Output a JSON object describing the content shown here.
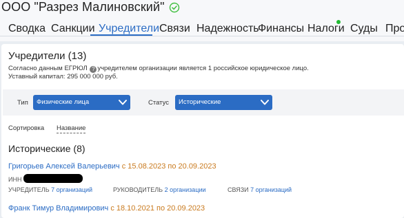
{
  "company": {
    "name": "ООО \"Разрез Малиновский\""
  },
  "tabs": [
    {
      "label": "Сводка"
    },
    {
      "label": "Санкции"
    },
    {
      "label": "Учредители"
    },
    {
      "label": "Связи"
    },
    {
      "label": "Надежность"
    },
    {
      "label": "Финансы"
    },
    {
      "label": "Налоги"
    },
    {
      "label": "Суды"
    },
    {
      "label": "Пров"
    }
  ],
  "colors": {
    "accent": "#2b6cc4",
    "dates": "#c97a1e",
    "notification_dot": "#22bb33",
    "verified": "#3fbf3f"
  },
  "section": {
    "title": "Учредители (13)",
    "desc_before": "Согласно данным ЕГРЮЛ ",
    "desc_after": "учредителем организации является 1 российское юридическое лицо.",
    "capital": "Уставный капитал: 295 000 000 руб."
  },
  "filters": {
    "type_label": "Тип",
    "type_value": "Физические лица",
    "status_label": "Статус",
    "status_value": "Исторические"
  },
  "sort": {
    "label": "Сортировка",
    "value": "Название"
  },
  "group": {
    "title": "Исторические (8)"
  },
  "persons": [
    {
      "name": "Григорьев Алексей Валерьевич",
      "dates": " с 15.08.2023 по 20.09.2023",
      "inn_label": "ИНН",
      "founder_label": "УЧРЕДИТЕЛЬ",
      "founder_value": "7 организаций",
      "director_label": "РУКОВОДИТЕЛЬ",
      "director_value": "2 организации",
      "links_label": "СВЯЗИ",
      "links_value": "7 организаций"
    },
    {
      "name": "Франк Тимур Владимирович",
      "dates": " с 18.10.2021 по 20.09.2023"
    }
  ]
}
